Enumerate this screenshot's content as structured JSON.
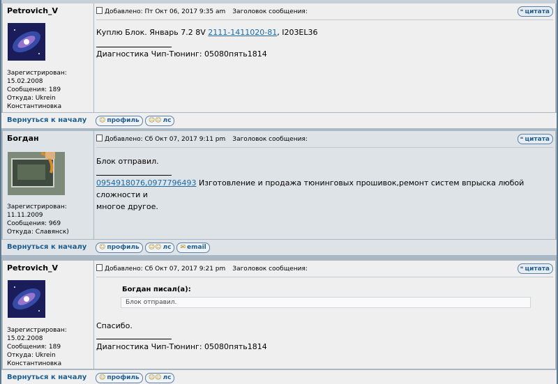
{
  "posts": [
    {
      "author": "Petrovich_V",
      "posted": "Добавлено: Пт Окт 06, 2017 9:35 am",
      "subject_label": "Заголовок сообщения:",
      "quote_label": "цитата",
      "body_text": "Куплю Блок. Январь 7.2 8V ",
      "body_link": "2111-1411020-81",
      "body_suffix": ", I203EL36",
      "signature": "Диагностика Чип-Тюнинг: 05080пять1814",
      "meta": {
        "registered_label": "Зарегистрирован:",
        "registered": "15.02.2008",
        "messages": "Сообщения: 189",
        "from": "Откуда: Ukrein",
        "from2": "Константиновка"
      },
      "back_label": "Вернуться к началу",
      "btn_profile": "профиль",
      "btn_pm": "лс"
    },
    {
      "author": "Богдан",
      "posted": "Добавлено: Сб Окт 07, 2017 9:11 pm",
      "subject_label": "Заголовок сообщения:",
      "quote_label": "цитата",
      "body_text": "Блок отправил.",
      "sig_link": "0954918076,0977796493",
      "signature": " Изготовление и продажа тюнинговых прошивок,ремонт систем впрыска любой сложности и",
      "signature2": "многое другое.",
      "meta": {
        "registered_label": "Зарегистрирован:",
        "registered": "11.11.2009",
        "messages": "Сообщения: 969",
        "from": "Откуда: Славянск)"
      },
      "back_label": "Вернуться к началу",
      "btn_profile": "профиль",
      "btn_pm": "лс",
      "btn_email": "email"
    },
    {
      "author": "Petrovich_V",
      "posted": "Добавлено: Сб Окт 07, 2017 9:21 pm",
      "subject_label": "Заголовок сообщения:",
      "quote_label": "цитата",
      "quote_author": "Богдан писал(а):",
      "quote_text": "Блок отправил.",
      "body_text": "Спасибо.",
      "signature": "Диагностика Чип-Тюнинг: 05080пять1814",
      "meta": {
        "registered_label": "Зарегистрирован:",
        "registered": "15.02.2008",
        "messages": "Сообщения: 189",
        "from": "Откуда: Ukrein",
        "from2": "Константиновка"
      },
      "back_label": "Вернуться к началу",
      "btn_profile": "профиль",
      "btn_pm": "лс"
    }
  ]
}
